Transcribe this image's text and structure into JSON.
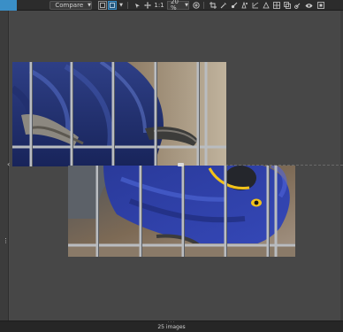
{
  "toolbar": {
    "compare_label": "Compare",
    "zoom_ratio": "1:1",
    "zoom_percent": "20 %",
    "accent_color": "#3a8fc7",
    "icons": [
      "compare-icon",
      "single-view-icon",
      "split-view-icon",
      "select-icon",
      "pan-icon",
      "zoom-in-icon",
      "crop-icon",
      "eyedropper-icon",
      "brush-icon",
      "spot-heal-icon",
      "pen-icon",
      "shape-icon",
      "grid-icon",
      "clone-icon",
      "link-icon",
      "eye-icon",
      "layer-icon"
    ]
  },
  "status": {
    "image_count": "25 images"
  }
}
